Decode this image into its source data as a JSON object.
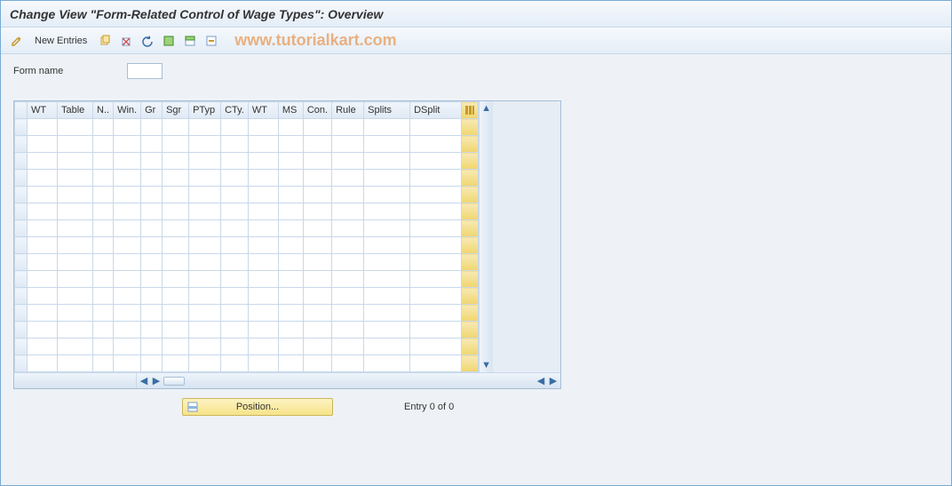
{
  "title": "Change View \"Form-Related Control of Wage Types\": Overview",
  "toolbar": {
    "new_entries_label": "New Entries"
  },
  "watermark": "www.tutorialkart.com",
  "field": {
    "form_name_label": "Form name",
    "form_name_value": ""
  },
  "grid": {
    "columns": [
      "WT",
      "Table",
      "N..",
      "Win.",
      "Gr",
      "Sgr",
      "PTyp",
      "CTy.",
      "WT",
      "MS",
      "Con.",
      "Rule",
      "Splits",
      "DSplit"
    ],
    "row_count": 15
  },
  "footer": {
    "position_label": "Position...",
    "entry_text": "Entry 0 of 0"
  }
}
